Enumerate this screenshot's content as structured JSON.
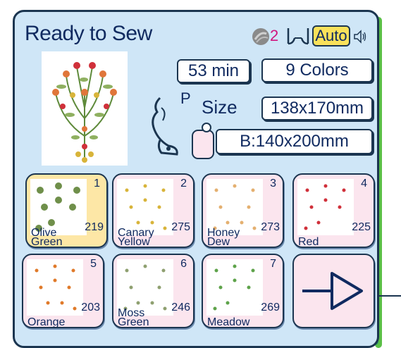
{
  "screen": {
    "title": "Ready to Sew",
    "needle_count": "2",
    "auto_button": "Auto"
  },
  "info": {
    "time": "53 min",
    "colors": "9 Colors",
    "presser_foot": "P",
    "size_label": "Size",
    "size": "138x170mm",
    "hoop": "B:140x200mm"
  },
  "threads": [
    {
      "number": "1",
      "name": "Olive Green",
      "stitches": "219",
      "selected": true,
      "color": "#6f8f4a"
    },
    {
      "number": "2",
      "name": "Canary Yellow",
      "stitches": "275",
      "selected": false,
      "color": "#d8b43a"
    },
    {
      "number": "3",
      "name": "Honey Dew",
      "stitches": "273",
      "selected": false,
      "color": "#e4b070"
    },
    {
      "number": "4",
      "name": "Red",
      "stitches": "225",
      "selected": false,
      "color": "#d0303a"
    },
    {
      "number": "5",
      "name": "Orange",
      "stitches": "203",
      "selected": false,
      "color": "#e07a2a"
    },
    {
      "number": "6",
      "name": "Moss Green",
      "stitches": "246",
      "selected": false,
      "color": "#8fa070"
    },
    {
      "number": "7",
      "name": "Meadow",
      "stitches": "269",
      "selected": false,
      "color": "#5ea34a"
    }
  ],
  "colors": {
    "panel_bg": "#cfe6f7",
    "frame": "#1b3550",
    "accent_pink": "#d0157e",
    "auto_yellow": "#f9e15a",
    "tab_stack": [
      "#3a9bd6",
      "#e6bb1d",
      "#2d9b6d",
      "#5bbf47"
    ]
  },
  "icons": {
    "thread": "thread-spool-icon",
    "presser": "presser-foot-icon",
    "sound": "speaker-icon",
    "hoop": "hoop-icon",
    "next": "arrow-right-icon"
  }
}
